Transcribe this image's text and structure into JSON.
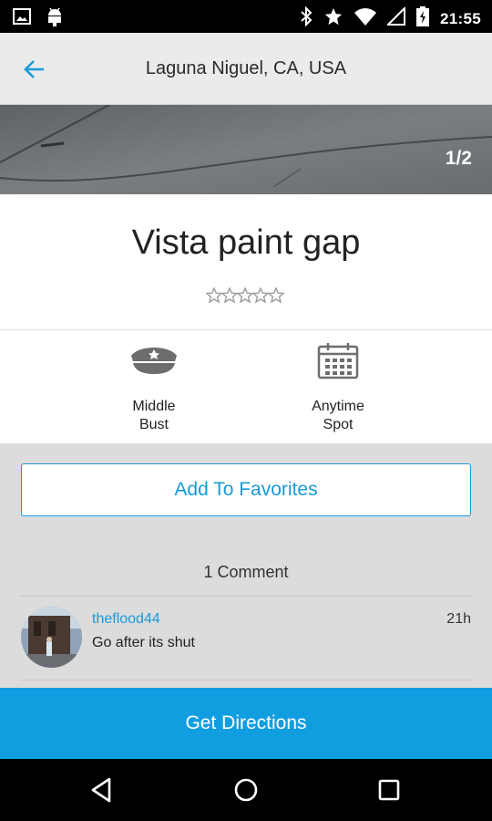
{
  "status_bar": {
    "time": "21:55",
    "icons_left": [
      "image-notification-icon",
      "android-notification-icon"
    ],
    "icons_right": [
      "bluetooth-icon",
      "star-icon",
      "wifi-icon",
      "signal-icon",
      "battery-charging-icon"
    ]
  },
  "header": {
    "title": "Laguna Niguel, CA,  USA",
    "back_icon": "arrow-left-icon",
    "accent": "#1a9ad6"
  },
  "photo": {
    "counter": "1/2"
  },
  "spot": {
    "title": "Vista paint gap",
    "rating": {
      "value": 0,
      "max": 5
    }
  },
  "attributes": [
    {
      "icon": "police-cap-icon",
      "line1": "Middle",
      "line2": "Bust"
    },
    {
      "icon": "calendar-icon",
      "line1": "Anytime",
      "line2": "Spot"
    }
  ],
  "favorites": {
    "label": "Add To Favorites"
  },
  "comments": {
    "count_label": "1 Comment",
    "items": [
      {
        "user": "theflood44",
        "time": "21h",
        "text": "Go after its shut"
      }
    ]
  },
  "directions": {
    "label": "Get Directions",
    "color": "#109ee0"
  },
  "nav": {
    "icons": [
      "back-triangle-icon",
      "home-circle-icon",
      "recents-square-icon"
    ]
  }
}
